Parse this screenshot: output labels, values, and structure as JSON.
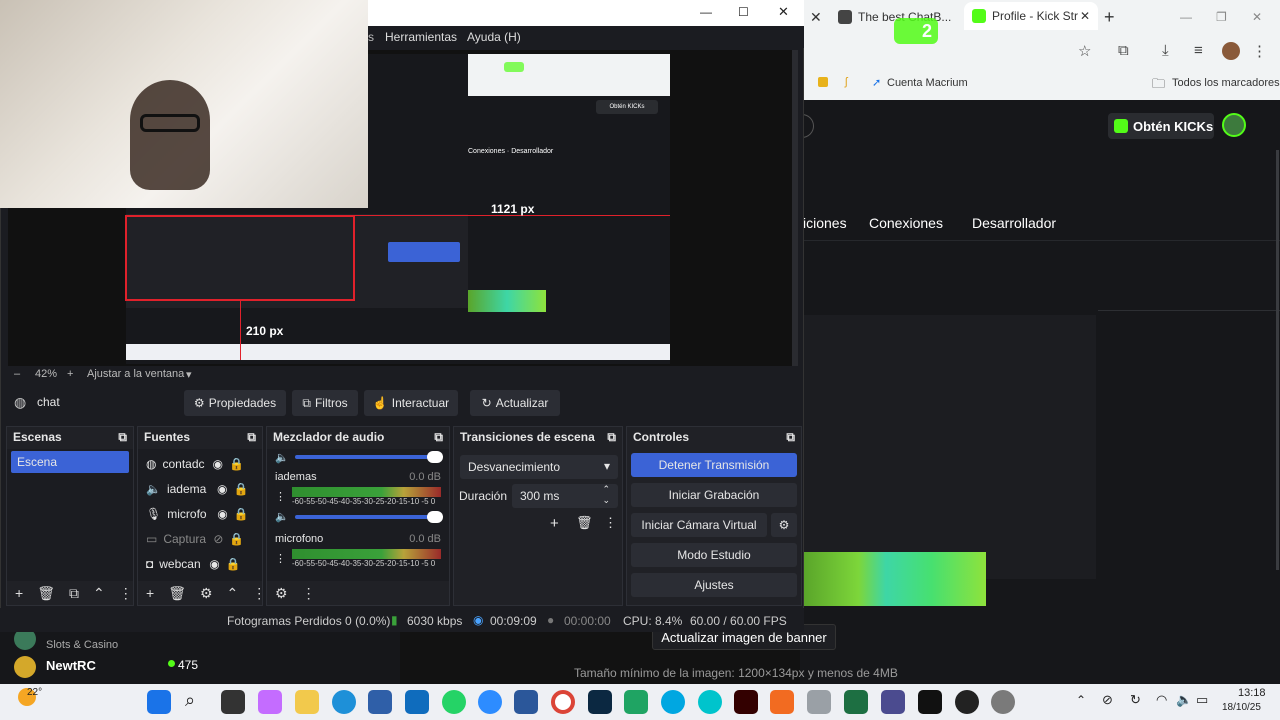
{
  "obs": {
    "menu": {
      "tools": "Herramientas",
      "help": "Ayuda (H)"
    },
    "preview": {
      "label_width": "1121 px",
      "label_height": "210 px"
    },
    "zoom": {
      "minus": "–",
      "value": "42%",
      "plus": "+",
      "fit": "Ajustar a la ventana",
      "caret": "▾"
    },
    "source_name": "chat",
    "toolbar": {
      "properties": "Propiedades",
      "filters": "Filtros",
      "interact": "Interactuar",
      "refresh": "Actualizar"
    },
    "scenes": {
      "title": "Escenas",
      "items": [
        "Escena"
      ]
    },
    "sources": {
      "title": "Fuentes",
      "items": [
        {
          "label": "contadc",
          "icon": "globe-icon"
        },
        {
          "label": "iadema",
          "icon": "speaker-icon"
        },
        {
          "label": "microfo",
          "icon": "mic-icon"
        },
        {
          "label": "Captura",
          "icon": "window-icon"
        },
        {
          "label": "webcan",
          "icon": "camera-icon"
        }
      ]
    },
    "mixer": {
      "title": "Mezclador de audio",
      "channels": [
        {
          "name": "iademas",
          "db": "0.0 dB",
          "volume": 1.0
        },
        {
          "name": "microfono",
          "db": "0.0 dB",
          "volume": 1.0
        }
      ],
      "scale": "-60-55-50-45-40-35-30-25-20-15-10 -5 0"
    },
    "transitions": {
      "title": "Transiciones de escena",
      "type": "Desvanecimiento",
      "duration_label": "Duración",
      "duration_value": "300 ms"
    },
    "controls": {
      "title": "Controles",
      "stop_stream": "Detener Transmisión",
      "start_recording": "Iniciar Grabación",
      "virtual_cam": "Iniciar Cámara Virtual",
      "studio_mode": "Modo Estudio",
      "settings": "Ajustes"
    },
    "status": {
      "dropped": "Fotogramas Perdidos 0 (0.0%)",
      "bitrate": "6030 kbps",
      "stream_time": "00:09:09",
      "rec_time": "00:00:00",
      "cpu": "CPU: 8.4%",
      "fps": "60.00 / 60.00 FPS"
    }
  },
  "browser": {
    "tabs": [
      {
        "label": "The best ChatB..."
      },
      {
        "label": "Profile - Kick Str"
      }
    ],
    "badge_count": "2",
    "bookmarks": {
      "macrium": "Cuenta Macrium",
      "all": "Todos los marcadores"
    },
    "kick": {
      "get_kicks": "Obtén KICKs",
      "nav": [
        "iciones",
        "Conexiones",
        "Desarrollador"
      ],
      "update_banner": "Actualizar imagen de banner",
      "min_size": "Tamaño mínimo de la imagen: 1200×134px y menos de 4MB"
    }
  },
  "chat": {
    "user1": "NewtRC",
    "user1_sub": "Slots & Casino",
    "viewers": "475"
  },
  "taskbar": {
    "weather": "22°",
    "time": "13:18",
    "date": "18/10/25"
  },
  "colors": {
    "obs_bg": "#1b1c21",
    "obs_accent": "#3b63d6",
    "kick_green": "#53fc18",
    "selection_red": "#e0212b"
  }
}
